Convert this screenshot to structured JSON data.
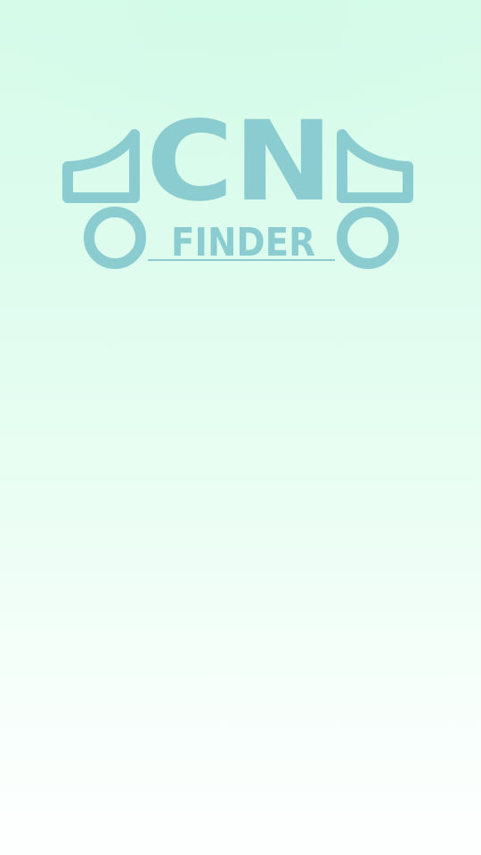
{
  "splash": {
    "logo": {
      "wordmark_main": "CN",
      "wordmark_sub": "FINDER",
      "color": "#8accd0"
    },
    "background": {
      "top_color": "#d6fbe9",
      "bottom_color": "#fdfffe"
    }
  }
}
